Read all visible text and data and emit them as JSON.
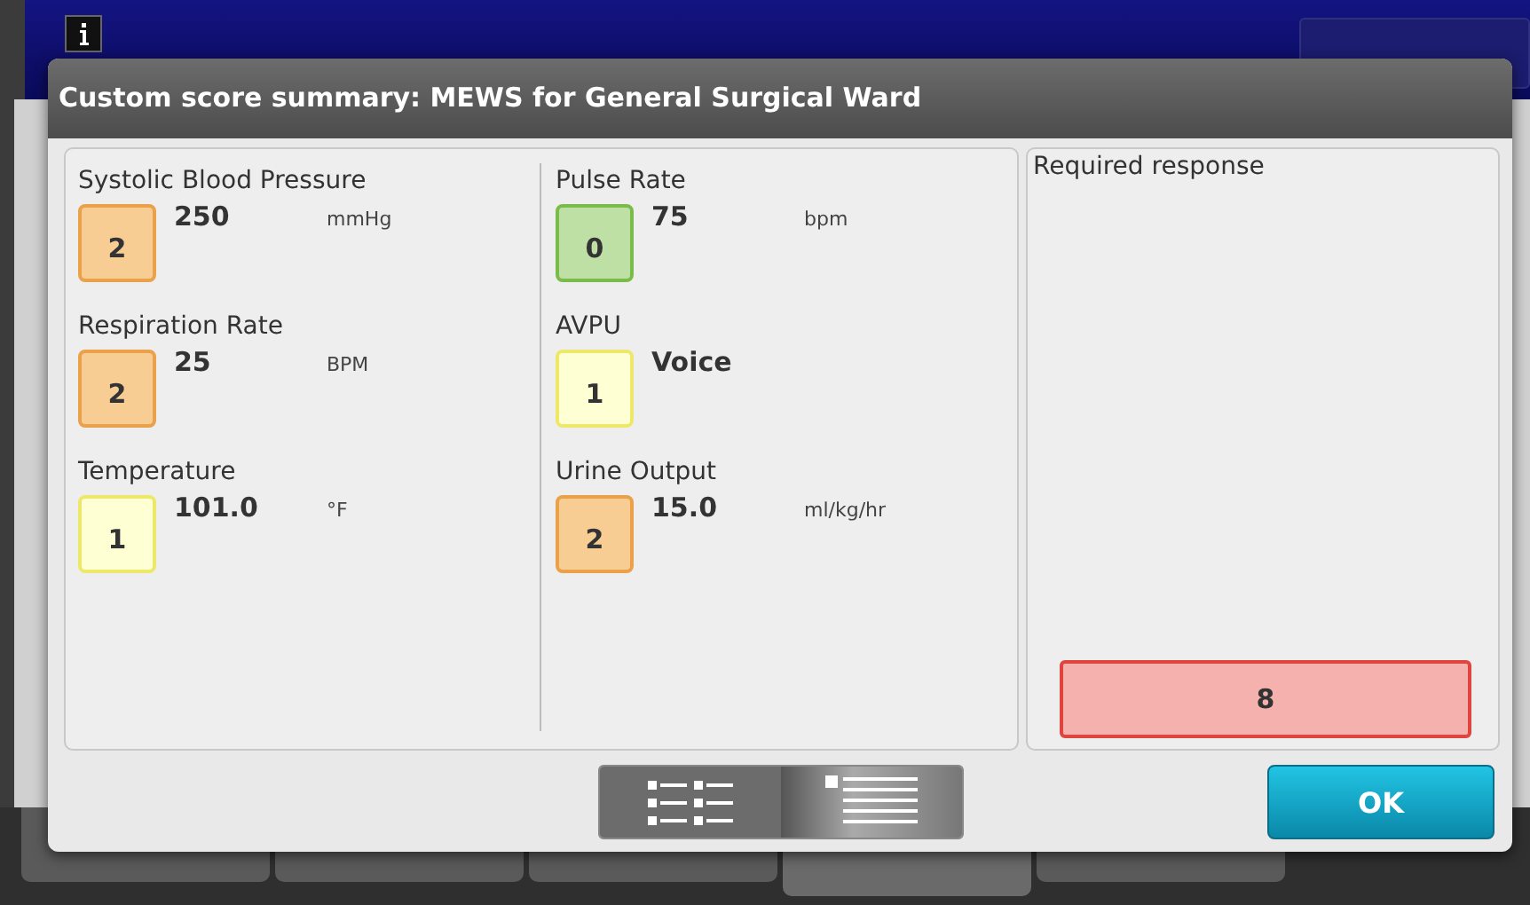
{
  "background": {
    "tabs": [
      {
        "selected": false
      },
      {
        "selected": false
      },
      {
        "selected": false
      },
      {
        "selected": true
      },
      {
        "selected": false
      }
    ]
  },
  "dialog": {
    "title": "Custom score summary: MEWS for General Surgical Ward",
    "columns": [
      [
        {
          "name": "Systolic Blood Pressure",
          "score": "2",
          "color": "#f8cd94",
          "value": "250",
          "unit": "mmHg"
        },
        {
          "name": "Respiration Rate",
          "score": "2",
          "color": "#f8cd94",
          "value": "25",
          "unit": "BPM"
        },
        {
          "name": "Temperature",
          "score": "1",
          "color": "#ffffd4",
          "value": "101.0",
          "unit": "°F"
        }
      ],
      [
        {
          "name": "Pulse Rate",
          "score": "0",
          "color": "#bfe0a4",
          "value": "75",
          "unit": "bpm"
        },
        {
          "name": "AVPU",
          "score": "1",
          "color": "#ffffd4",
          "value": "Voice"
        },
        {
          "name": "Urine Output",
          "score": "2",
          "color": "#f8cd94",
          "value": "15.0",
          "unit": "ml/kg/hr"
        }
      ]
    ],
    "response": {
      "label": "Required response",
      "total": "8",
      "color": "#f4b1ae"
    },
    "view_toggle": [
      {
        "kind": "columns",
        "selected": true
      },
      {
        "kind": "list",
        "selected": false
      }
    ],
    "ok": "OK"
  }
}
